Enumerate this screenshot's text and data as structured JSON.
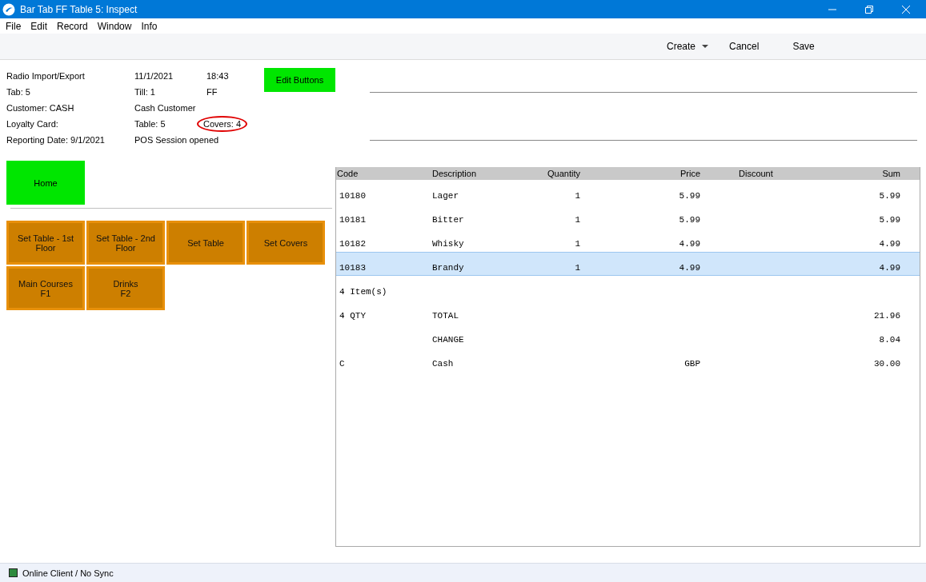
{
  "window": {
    "title": "Bar Tab FF Table 5: Inspect"
  },
  "menu": [
    "File",
    "Edit",
    "Record",
    "Window",
    "Info"
  ],
  "toolbar": [
    {
      "label": "Create",
      "kind": "dropdown"
    },
    {
      "label": "Cancel",
      "kind": "plain"
    },
    {
      "label": "Save",
      "kind": "plain"
    }
  ],
  "info": [
    {
      "cells": [
        {
          "text": "Radio Import/Export"
        },
        {
          "text": "11/1/2021"
        },
        {
          "text": "18:43"
        }
      ]
    },
    {
      "cells": [
        {
          "text": "Tab: 5"
        },
        {
          "text": "Till: 1"
        },
        {
          "text": "FF"
        }
      ]
    },
    {
      "cells": [
        {
          "text": "Customer: CASH"
        },
        {
          "text": "Cash Customer"
        }
      ]
    },
    {
      "cells": [
        {
          "text": "Loyalty Card:"
        },
        {
          "text": "Table: 5"
        },
        {
          "text": "Covers: 4",
          "circled": true
        }
      ]
    },
    {
      "cells": [
        {
          "text": "Reporting Date: 9/1/2021"
        },
        {
          "text": "POS Session opened"
        }
      ]
    }
  ],
  "edit_button": "Edit Buttons",
  "home_button": "Home",
  "pos_buttons": [
    "Set Table - 1st Floor",
    "Set Table - 2nd Floor",
    "Set Table",
    "Set Covers",
    "Main Courses\nF1",
    "Drinks\nF2"
  ],
  "table": {
    "columns": [
      "Code",
      "Description",
      "Quantity",
      "Price",
      "Discount",
      "Sum"
    ],
    "rows": [
      {
        "selected": false,
        "code": "10180",
        "description": "Lager",
        "quantity": "1",
        "price": "5.99",
        "sum": "5.99"
      },
      {
        "selected": false,
        "code": "10181",
        "description": "Bitter",
        "quantity": "1",
        "price": "5.99",
        "sum": "5.99"
      },
      {
        "selected": false,
        "code": "10182",
        "description": "Whisky",
        "quantity": "1",
        "price": "4.99",
        "sum": "4.99"
      },
      {
        "selected": true,
        "code": "10183",
        "description": "Brandy",
        "quantity": "1",
        "price": "4.99",
        "sum": "4.99"
      },
      {
        "selected": false,
        "code": "4 Item(s)"
      },
      {
        "selected": false,
        "code": "4 QTY",
        "description": "TOTAL",
        "sum": "21.96"
      },
      {
        "selected": false,
        "description": "CHANGE",
        "sum": "8.04"
      },
      {
        "selected": false,
        "code": "C",
        "description": "Cash",
        "price": "GBP",
        "sum": "30.00"
      }
    ]
  },
  "status_bar": "Online Client / No Sync"
}
